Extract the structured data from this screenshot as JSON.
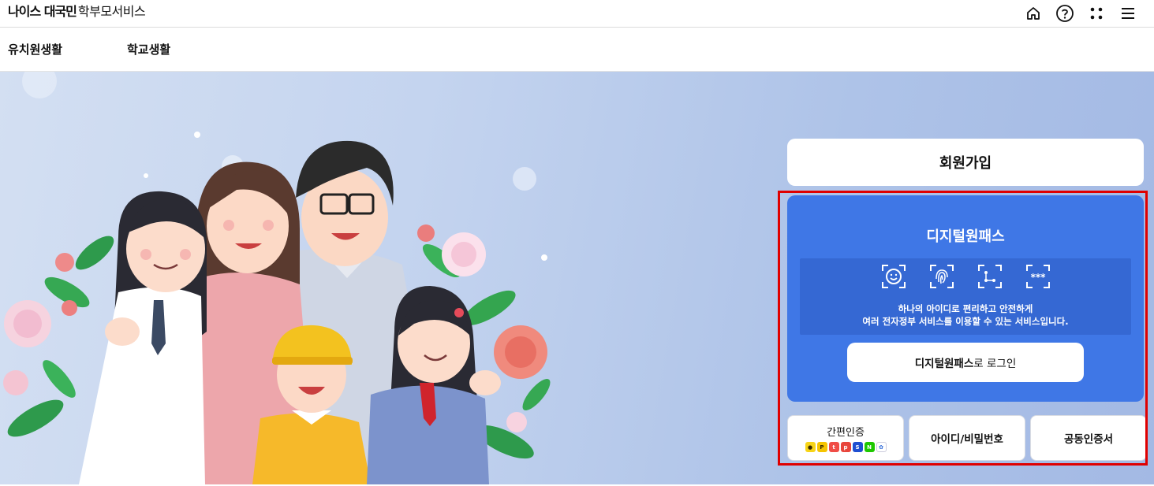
{
  "header": {
    "brand_bold": "나이스 대국민",
    "brand_light": "학부모서비스",
    "icons": [
      "home-icon",
      "help-icon",
      "apps-icon",
      "menu-icon"
    ]
  },
  "nav": {
    "items": [
      {
        "label": "유치원생활"
      },
      {
        "label": "학교생활"
      }
    ]
  },
  "panel": {
    "signup_label": "회원가입",
    "digital_pass": {
      "title": "디지털원패스",
      "icons": [
        "face-auth-icon",
        "fingerprint-icon",
        "pattern-icon",
        "pin-icon"
      ],
      "desc_line1": "하나의 아이디로 편리하고 안전하게",
      "desc_line2": "여러 전자정부 서비스를 이용할 수 있는 서비스입니다.",
      "login_bold": "디지털원패스",
      "login_rest": "로 로그인"
    },
    "auth": {
      "simple_label": "간편인증",
      "simple_logos": [
        "kakao",
        "pass",
        "toss",
        "payco",
        "samsung",
        "naver",
        "kb"
      ],
      "id_pw_label": "아이디/비밀번호",
      "cert_label": "공동인증서"
    }
  },
  "colors": {
    "digital_pass_bg": "#3f77e6",
    "digital_pass_inner": "#3568d3",
    "highlight_border": "#e00000"
  }
}
